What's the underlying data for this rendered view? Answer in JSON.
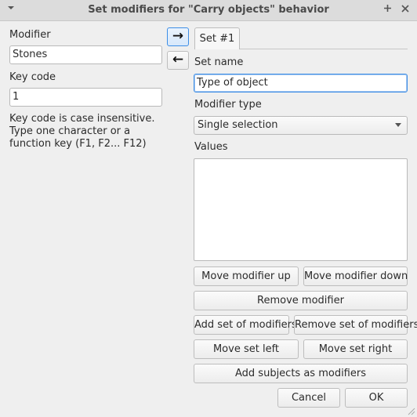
{
  "window": {
    "title": "Set modifiers for \"Carry objects\" behavior",
    "menu_icon": "chevron-down-icon",
    "pin_icon": "plus-icon",
    "close_icon": "close-icon"
  },
  "left": {
    "modifier_label": "Modifier",
    "modifier_value": "Stones",
    "keycode_label": "Key code",
    "keycode_value": "1",
    "description": "Key code is case insensitive. Type one character or a function key (F1, F2... F12)"
  },
  "arrows": {
    "right": "→",
    "left": "←"
  },
  "right": {
    "tab_label": "Set #1",
    "set_name_label": "Set name",
    "set_name_value": "Type of object",
    "modifier_type_label": "Modifier type",
    "modifier_type_value": "Single selection",
    "values_label": "Values"
  },
  "buttons": {
    "move_up": "Move modifier up",
    "move_down": "Move modifier down",
    "remove_modifier": "Remove modifier",
    "add_set": "Add set of modifiers",
    "remove_set": "Remove set of modifiers",
    "move_left": "Move set left",
    "move_right": "Move set right",
    "add_subjects": "Add subjects as modifiers",
    "cancel": "Cancel",
    "ok": "OK"
  }
}
